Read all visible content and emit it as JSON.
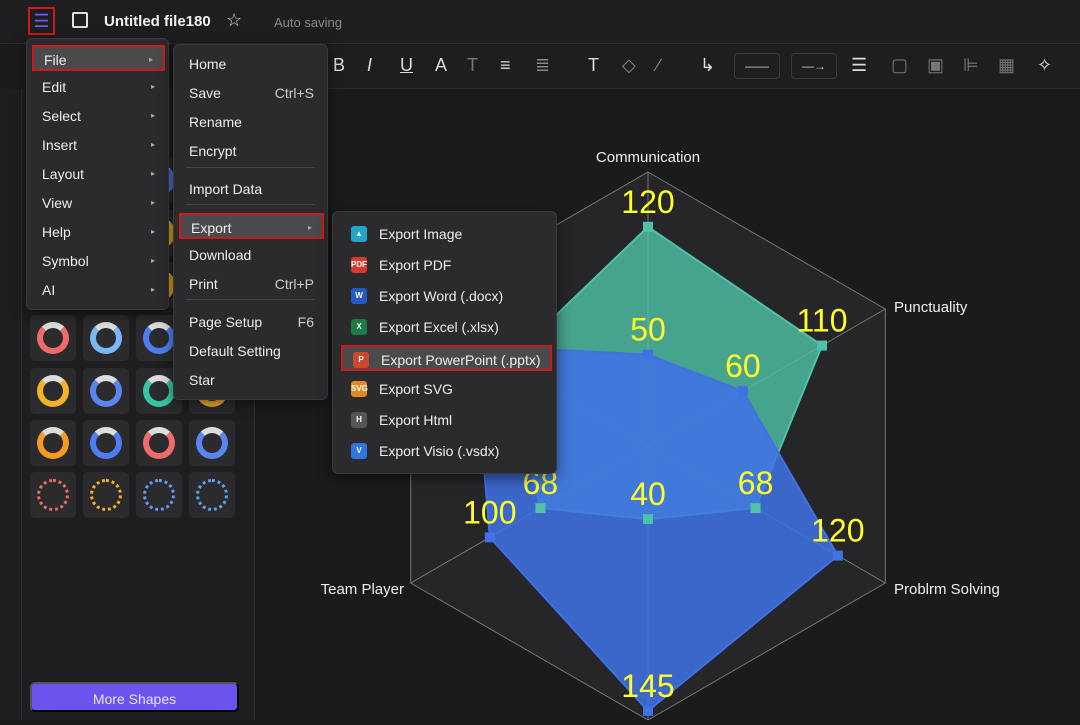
{
  "header": {
    "title": "Untitled file180",
    "autosave": "Auto saving"
  },
  "toolbar": {
    "line_style": "——",
    "arrow_style": "—→"
  },
  "sidebar": {
    "more_shapes": "More Shapes"
  },
  "main_menu": [
    {
      "label": "File",
      "arrow": "▸"
    },
    {
      "label": "Edit",
      "arrow": "▸"
    },
    {
      "label": "Select",
      "arrow": "▸"
    },
    {
      "label": "Insert",
      "arrow": "▸"
    },
    {
      "label": "Layout",
      "arrow": "▸"
    },
    {
      "label": "View",
      "arrow": "▸"
    },
    {
      "label": "Help",
      "arrow": "▸"
    },
    {
      "label": "Symbol",
      "arrow": "▸"
    },
    {
      "label": "AI",
      "arrow": "▸"
    }
  ],
  "file_menu": [
    {
      "label": "Home",
      "shortcut": ""
    },
    {
      "label": "Save",
      "shortcut": "Ctrl+S"
    },
    {
      "label": "Rename",
      "shortcut": ""
    },
    {
      "label": "Encrypt",
      "shortcut": ""
    },
    {
      "label": "Import Data",
      "shortcut": ""
    },
    {
      "label": "Export",
      "shortcut": "▸"
    },
    {
      "label": "Download",
      "shortcut": ""
    },
    {
      "label": "Print",
      "shortcut": "Ctrl+P"
    },
    {
      "label": "Page Setup",
      "shortcut": "F6"
    },
    {
      "label": "Default Setting",
      "shortcut": ""
    },
    {
      "label": "Star",
      "shortcut": ""
    }
  ],
  "export_menu": [
    {
      "label": "Export Image",
      "icon": "image-icon",
      "badge": "▲",
      "color": "#21a5c9"
    },
    {
      "label": "Export PDF",
      "icon": "pdf-icon",
      "badge": "PDF",
      "color": "#d63b30"
    },
    {
      "label": "Export Word (.docx)",
      "icon": "word-icon",
      "badge": "W",
      "color": "#2458c2"
    },
    {
      "label": "Export Excel (.xlsx)",
      "icon": "excel-icon",
      "badge": "X",
      "color": "#1d7a43"
    },
    {
      "label": "Export PowerPoint (.pptx)",
      "icon": "powerpoint-icon",
      "badge": "P",
      "color": "#c94a2b"
    },
    {
      "label": "Export SVG",
      "icon": "svg-icon",
      "badge": "SVG",
      "color": "#e08a1f"
    },
    {
      "label": "Export Html",
      "icon": "html-icon",
      "badge": "H",
      "color": "#555558"
    },
    {
      "label": "Export Visio (.vsdx)",
      "icon": "visio-icon",
      "badge": "V",
      "color": "#2f74e0"
    }
  ],
  "chart_data": {
    "type": "radar",
    "axes": [
      "Communication",
      "Punctuality",
      "Problrm Solving",
      "",
      "Team Player",
      ""
    ],
    "rmax": 150,
    "rings": 5,
    "series": [
      {
        "values": [
          120,
          110,
          68,
          40,
          68,
          null
        ],
        "color": "#4fc3a7"
      },
      {
        "values": [
          50,
          60,
          120,
          145,
          100,
          null
        ],
        "color": "#3f72e6"
      }
    ],
    "label_color": "#ffff2a"
  }
}
